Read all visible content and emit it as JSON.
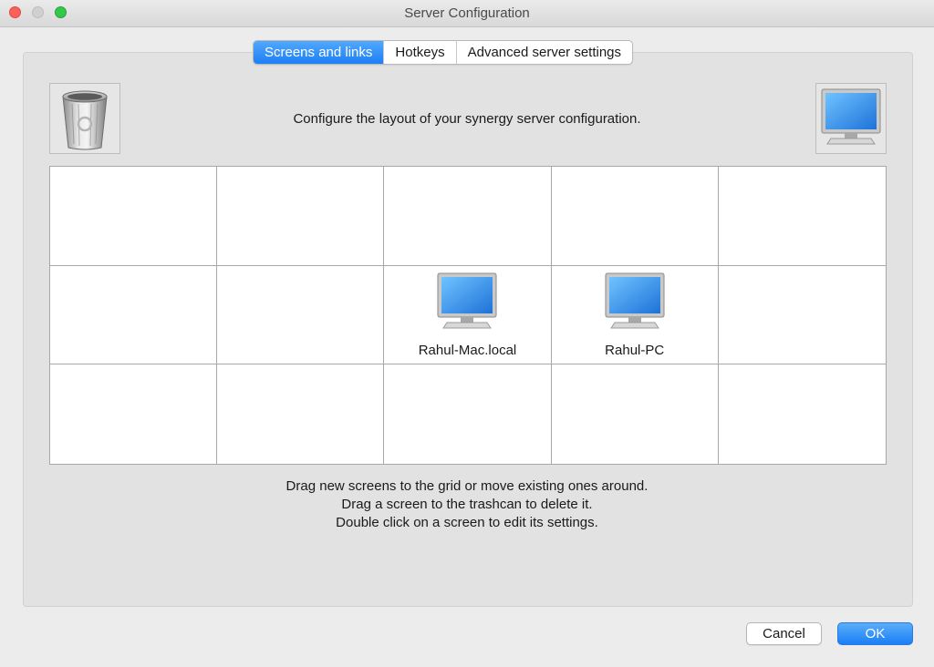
{
  "window": {
    "title": "Server Configuration"
  },
  "tabs": [
    {
      "label": "Screens and links",
      "active": true
    },
    {
      "label": "Hotkeys",
      "active": false
    },
    {
      "label": "Advanced server settings",
      "active": false
    }
  ],
  "icons": {
    "trash": "trash-icon",
    "new_screen": "monitor-icon"
  },
  "description": "Configure the layout of your synergy server configuration.",
  "grid": {
    "columns": 5,
    "rows": 3,
    "screens": [
      {
        "name": "Rahul-Mac.local",
        "row": 2,
        "column": 3
      },
      {
        "name": "Rahul-PC",
        "row": 2,
        "column": 4
      }
    ]
  },
  "instructions": [
    "Drag new screens to the grid or move existing ones around.",
    "Drag a screen to the trashcan to delete it.",
    "Double click on a screen to edit its settings."
  ],
  "buttons": {
    "cancel": "Cancel",
    "ok": "OK"
  },
  "colors": {
    "accent": "#1d7ff5",
    "close": "#fc605b",
    "zoom": "#34c84a"
  }
}
